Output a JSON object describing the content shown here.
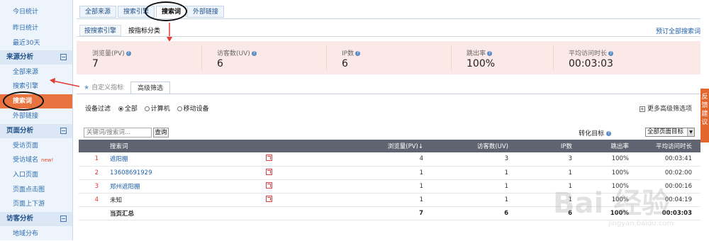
{
  "sidebar": {
    "items": [
      {
        "label": "今日统计"
      },
      {
        "label": "昨日统计"
      },
      {
        "label": "最近30天"
      }
    ],
    "sections": [
      {
        "title": "来源分析",
        "toggle": "⊟",
        "items": [
          {
            "label": "全部来源"
          },
          {
            "label": "搜索引擎"
          },
          {
            "label": "搜索词"
          },
          {
            "label": "外部链接"
          }
        ]
      },
      {
        "title": "页面分析",
        "toggle": "⊟",
        "items": [
          {
            "label": "受访页面"
          },
          {
            "label": "受访域名",
            "badge": "new!"
          },
          {
            "label": "入口页面"
          },
          {
            "label": "页面点击图"
          },
          {
            "label": "页面上下游"
          }
        ]
      },
      {
        "title": "访客分析",
        "toggle": "⊟",
        "items": [
          {
            "label": "地域分布"
          }
        ]
      }
    ]
  },
  "top_tabs": [
    "全部来源",
    "搜索引擎",
    "搜索词",
    "外部链接"
  ],
  "sub_tabs": [
    "按搜索引擎",
    "按指标分类"
  ],
  "subscribe_link": "预订全部搜索词",
  "metrics": [
    {
      "label": "浏览量(PV)",
      "value": "7"
    },
    {
      "label": "访客数(UV)",
      "value": "6"
    },
    {
      "label": "IP数",
      "value": "6"
    },
    {
      "label": "跳出率",
      "value": "100%"
    },
    {
      "label": "平均访问时长",
      "value": "00:03:03"
    }
  ],
  "filter_tabs": {
    "custom": "自定义指标",
    "advanced": "高级筛选"
  },
  "device_filter": {
    "label": "设备过滤",
    "options": [
      "全部",
      "计算机",
      "移动设备"
    ],
    "selected": "全部"
  },
  "more_filters": "更多高级筛选项",
  "search": {
    "placeholder": "关键词/搜索词...",
    "button": "查询"
  },
  "conversion": {
    "label": "转化目标",
    "selected": "全部页面目标"
  },
  "table": {
    "headers": [
      "搜索词",
      "浏览量(PV)↓",
      "访客数(UV)",
      "IP数",
      "跳出率",
      "平均访问时长"
    ],
    "rows": [
      {
        "idx": "1",
        "keyword": "遮阳棚",
        "pv": "4",
        "uv": "3",
        "ip": "3",
        "bounce": "100%",
        "time": "00:03:41"
      },
      {
        "idx": "2",
        "keyword": "13608691929",
        "pv": "1",
        "uv": "1",
        "ip": "1",
        "bounce": "100%",
        "time": "00:02:00"
      },
      {
        "idx": "3",
        "keyword": "郑州遮阳棚",
        "pv": "1",
        "uv": "1",
        "ip": "1",
        "bounce": "100%",
        "time": "00:00:16"
      },
      {
        "idx": "4",
        "keyword": "未知",
        "pv": "1",
        "uv": "1",
        "ip": "1",
        "bounce": "100%",
        "time": "00:04:19"
      }
    ],
    "total": {
      "label": "当页汇总",
      "pv": "7",
      "uv": "6",
      "ip": "6",
      "bounce": "100%",
      "time": "00:03:03"
    }
  },
  "feedback": "反馈建议",
  "watermark": {
    "brand": "Bai 经验",
    "url": "jingyan.baidu.com"
  },
  "colors": {
    "active_orange": "#e8733f",
    "link_blue": "#1f5fa8",
    "metrics_bg": "#fbe9e7",
    "table_header": "#5f6470"
  }
}
